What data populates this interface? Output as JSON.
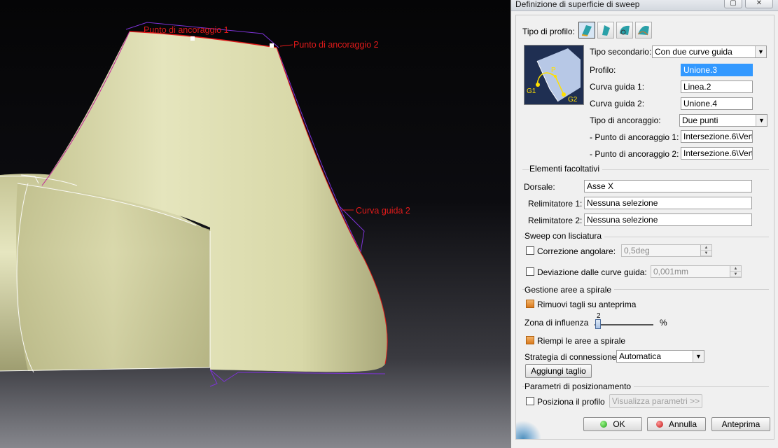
{
  "viewport": {
    "annotations": {
      "anchor1": "Punto di ancoraggio 1",
      "anchor2": "Punto di ancoraggio 2",
      "guide2": "Curva guida 2"
    }
  },
  "dialog": {
    "title": "Definizione di superficie di sweep",
    "profile_type_label": "Tipo di profilo:",
    "secondary_type_label": "Tipo secondario:",
    "secondary_type_value": "Con due curve guida",
    "preview_labels": {
      "p": "P",
      "g1": "G1",
      "g2": "G2"
    },
    "profile_label": "Profilo:",
    "profile_value": "Unione.3",
    "guide1_label": "Curva guida 1:",
    "guide1_value": "Linea.2",
    "guide2_label": "Curva guida 2:",
    "guide2_value": "Unione.4",
    "anchor_type_label": "Tipo di ancoraggio:",
    "anchor_type_value": "Due punti",
    "anchor1_label": "- Punto di ancoraggio 1:",
    "anchor1_value": "Intersezione.6\\Verti",
    "anchor2_label": "- Punto di ancoraggio 2:",
    "anchor2_value": "Intersezione.6\\Verti",
    "optional": {
      "title": "Elementi facoltativi",
      "spine_label": "Dorsale:",
      "spine_value": "Asse X",
      "relim1_label": "Relimitatore 1:",
      "relim1_value": "Nessuna selezione",
      "relim2_label": "Relimitatore 2:",
      "relim2_value": "Nessuna selezione"
    },
    "smoothing": {
      "title": "Sweep con lisciatura",
      "angular_label": "Correzione angolare:",
      "angular_value": "0,5deg",
      "deviation_label": "Deviazione dalle curve guida:",
      "deviation_value": "0,001mm"
    },
    "twist": {
      "title": "Gestione aree a spirale",
      "remove_cuts_label": "Rimuovi tagli su anteprima",
      "influence_label": "Zona di influenza",
      "influence_value": "2",
      "influence_unit": "%",
      "fill_label": "Riempi le aree a spirale",
      "strategy_label": "Strategia di connessione:",
      "strategy_value": "Automatica",
      "add_cut_label": "Aggiungi taglio"
    },
    "positioning": {
      "title": "Parametri di posizionamento",
      "position_label": "Posiziona il profilo",
      "show_params_label": "Visualizza parametri >>"
    },
    "buttons": {
      "ok": "OK",
      "cancel": "Annulla",
      "preview": "Anteprima"
    },
    "colors": {
      "surface": "#e3e3b4",
      "annotation": "#e01a1a",
      "selection": "#3399ff"
    }
  }
}
